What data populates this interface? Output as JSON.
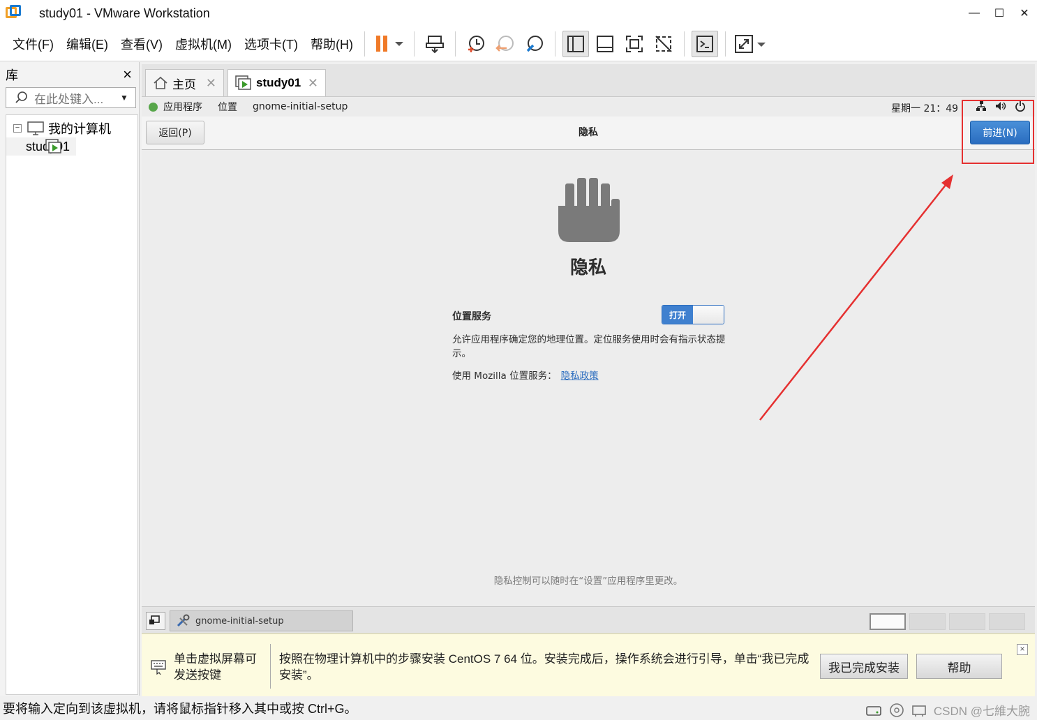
{
  "window": {
    "title": "study01 - VMware Workstation",
    "minimize": "—",
    "maximize": "☐",
    "close": "✕"
  },
  "menu": [
    "文件(F)",
    "编辑(E)",
    "查看(V)",
    "虚拟机(M)",
    "选项卡(T)",
    "帮助(H)"
  ],
  "library": {
    "title": "库",
    "close": "×",
    "search_placeholder": "在此处键入...",
    "tree": {
      "root": "我的计算机",
      "child": "study01",
      "expander": "−"
    }
  },
  "tabs": [
    {
      "label": "主页",
      "close": "✕"
    },
    {
      "label": "study01",
      "close": "✕"
    }
  ],
  "guest": {
    "topbar": {
      "applications": "应用程序",
      "places": "位置",
      "app_name": "gnome-initial-setup",
      "clock": "星期一 21：49"
    },
    "header": {
      "back": "返回(P)",
      "title": "隐私",
      "next": "前进(N)"
    },
    "privacy": {
      "title": "隐私",
      "location_label": "位置服务",
      "toggle_state": "打开",
      "toggle_on": true,
      "description": "允许应用程序确定您的地理位置。定位服务使用时会有指示状态提示。",
      "mozilla_text": "使用 Mozilla 位置服务：",
      "policy_link": "隐私政策",
      "footnote": "隐私控制可以随时在“设置”应用程序里更改。"
    },
    "taskbar": {
      "task": "gnome-initial-setup",
      "active_workspace": 1,
      "workspaces": 4
    }
  },
  "hint": {
    "left": "单击虚拟屏幕可发送按键",
    "main": "按照在物理计算机中的步骤安装 CentOS 7 64 位。安装完成后，操作系统会进行引导，单击“我已完成安装”。",
    "done_button": "我已完成安装",
    "help_button": "帮助",
    "close": "×"
  },
  "status": {
    "text": "要将输入定向到该虚拟机，请将鼠标指针移入其中或按 Ctrl+G。",
    "watermark": "CSDN @七維大腕"
  },
  "colors": {
    "accent_blue": "#3f80cf",
    "annotation_red": "#e53030",
    "pause_orange": "#f07a28"
  }
}
